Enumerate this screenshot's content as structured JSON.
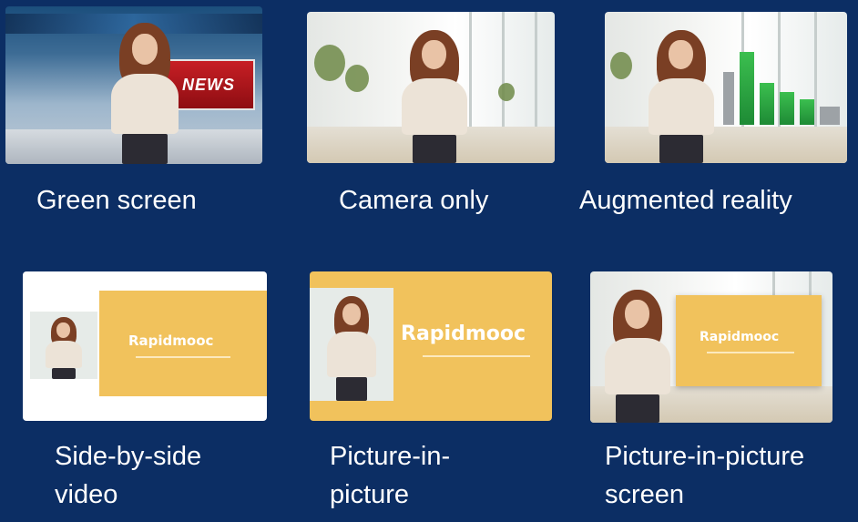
{
  "captions": {
    "green_screen": "Green screen",
    "camera_only": "Camera only",
    "augmented_reality": "Augmented reality",
    "side_by_side": "Side-by-side video",
    "picture_in_picture": "Picture-in-picture",
    "picture_in_picture_screen": "Picture-in-picture screen"
  },
  "thumbnails": {
    "news_banner": "NEWS",
    "slide_logo": "Rapidmooc"
  },
  "colors": {
    "background": "#0c2e64",
    "caption_text": "#ffffff",
    "slide_yellow": "#f1c25c",
    "news_red": "#c71f25",
    "ar_green": "#2fa845"
  }
}
